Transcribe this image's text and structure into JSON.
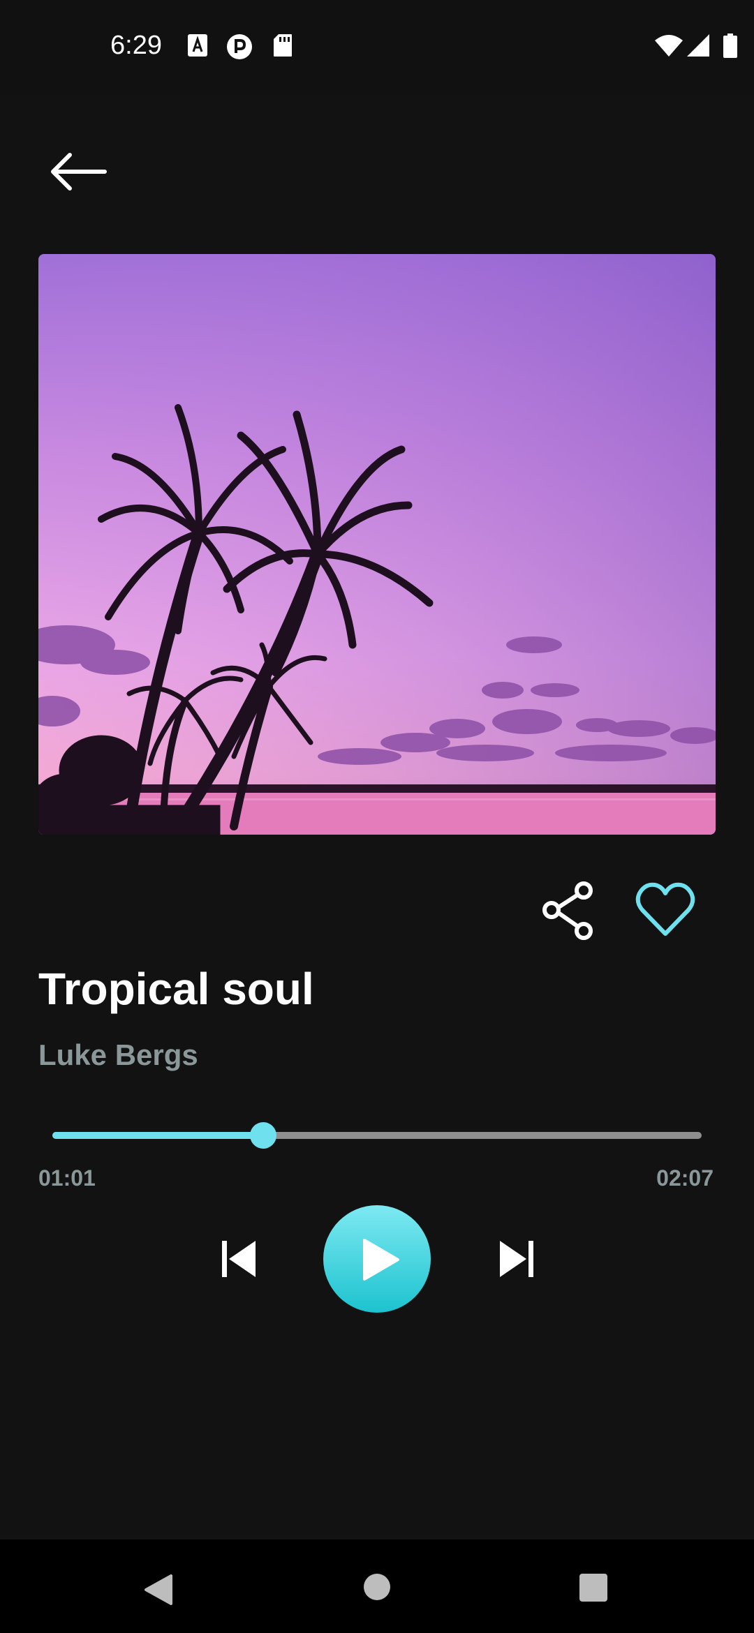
{
  "status_bar": {
    "time": "6:29",
    "icons": [
      "accessibility-icon",
      "notification-p-icon",
      "sd-card-icon",
      "wifi-icon",
      "signal-icon",
      "battery-icon"
    ]
  },
  "header": {
    "back_icon": "back-arrow-icon"
  },
  "artwork": {
    "description_icon": "album-artwork"
  },
  "actions": {
    "share_icon": "share-icon",
    "like_icon": "heart-icon"
  },
  "track": {
    "title": "Tropical soul",
    "artist": "Luke Bergs"
  },
  "playback": {
    "elapsed": "01:01",
    "total": "02:07",
    "progress": 0.325
  },
  "controls": {
    "prev_icon": "skip-previous-icon",
    "play_icon": "play-icon",
    "next_icon": "skip-next-icon"
  },
  "nav_bar": {
    "back_icon": "nav-back-icon",
    "home_icon": "nav-home-icon",
    "recents_icon": "nav-recents-icon"
  },
  "colors": {
    "background": "#121212",
    "accent": "#6fe0ee",
    "secondary_text": "#8a9899",
    "track_inactive": "#8e8e8e"
  }
}
